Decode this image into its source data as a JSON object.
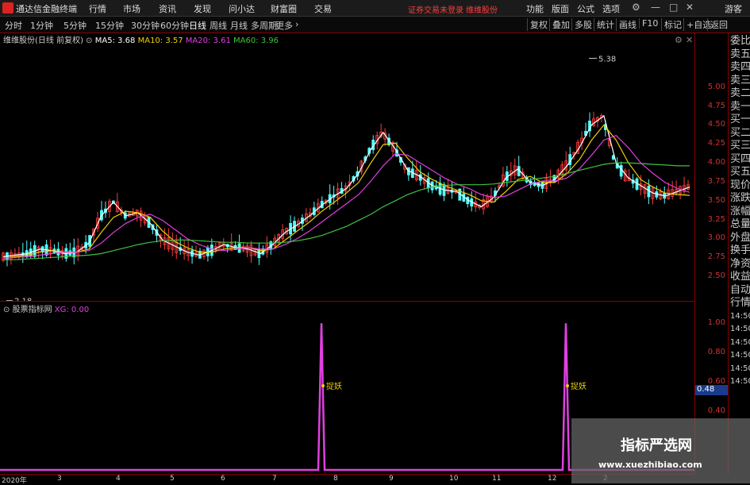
{
  "menubar": {
    "app_title": "通达信金融终端",
    "items": [
      "行情",
      "市场",
      "资讯",
      "发现",
      "问小达",
      "财富圈",
      "交易"
    ],
    "warning": "证券交易未登录",
    "stock_link": "维维股份",
    "right_items": [
      "功能",
      "版面",
      "公式",
      "选项"
    ],
    "guest": "游客"
  },
  "toolbar": {
    "periods": [
      "分时",
      "1分钟",
      "5分钟",
      "15分钟",
      "30分钟",
      "60分钟",
      "日线",
      "周线",
      "月线",
      "多周期",
      "更多"
    ],
    "active": "日线",
    "right_buttons": [
      "复权",
      "叠加",
      "多股",
      "统计",
      "画线",
      "F10",
      "标记",
      "+自选",
      "返回"
    ]
  },
  "main_legend": {
    "title": "维维股份(日线 前复权)",
    "ma5": "MA5: 3.68",
    "ma10": "MA10: 3.57",
    "ma20": "MA20: 3.61",
    "ma60": "MA60: 3.96"
  },
  "sub_legend": {
    "title": "股票指标网",
    "xg": "XG: 0.00"
  },
  "chart_data": [
    {
      "type": "candlestick",
      "title": "维维股份(日线 前复权)",
      "ylim": [
        2.25,
        5.5
      ],
      "yticks": [
        "5.00",
        "4.75",
        "4.50",
        "4.25",
        "4.00",
        "3.75",
        "3.50",
        "3.25",
        "3.00",
        "2.75",
        "2.50"
      ],
      "x_labels": [
        "2020年",
        "3",
        "4",
        "5",
        "6",
        "7",
        "8",
        "9",
        "10",
        "11",
        "12",
        "2"
      ],
      "annotations": {
        "max": "5.38",
        "min": "2.18"
      },
      "series": [
        {
          "name": "MA5",
          "color": "#ffffff",
          "values": [
            2.76,
            2.78,
            2.8,
            2.86,
            2.84,
            2.8,
            2.82,
            2.94,
            3.3,
            3.48,
            3.3,
            3.34,
            3.2,
            2.98,
            2.9,
            2.82,
            2.78,
            2.84,
            2.92,
            2.88,
            2.86,
            2.8,
            2.92,
            3.08,
            3.18,
            3.3,
            3.44,
            3.56,
            3.66,
            3.86,
            4.18,
            4.4,
            4.18,
            3.9,
            3.82,
            3.7,
            3.64,
            3.62,
            3.5,
            3.42,
            3.54,
            3.8,
            3.92,
            3.74,
            3.7,
            3.78,
            3.96,
            4.2,
            4.5,
            4.62,
            4.0,
            3.8,
            3.7,
            3.6,
            3.56,
            3.62,
            3.68
          ]
        },
        {
          "name": "MA10",
          "color": "#f0d000",
          "values": [
            2.74,
            2.76,
            2.78,
            2.82,
            2.84,
            2.82,
            2.82,
            2.86,
            3.08,
            3.28,
            3.36,
            3.34,
            3.28,
            3.1,
            2.96,
            2.88,
            2.82,
            2.82,
            2.86,
            2.88,
            2.88,
            2.84,
            2.86,
            2.98,
            3.1,
            3.22,
            3.36,
            3.48,
            3.6,
            3.74,
            4.0,
            4.24,
            4.26,
            4.06,
            3.88,
            3.78,
            3.7,
            3.64,
            3.58,
            3.5,
            3.48,
            3.62,
            3.78,
            3.82,
            3.74,
            3.74,
            3.86,
            4.04,
            4.3,
            4.5,
            4.3,
            4.0,
            3.78,
            3.68,
            3.6,
            3.58,
            3.57
          ]
        },
        {
          "name": "MA20",
          "color": "#e040e0",
          "values": [
            2.74,
            2.75,
            2.76,
            2.78,
            2.8,
            2.82,
            2.82,
            2.84,
            2.94,
            3.08,
            3.2,
            3.28,
            3.32,
            3.24,
            3.12,
            3.0,
            2.92,
            2.86,
            2.84,
            2.86,
            2.88,
            2.86,
            2.86,
            2.92,
            3.0,
            3.1,
            3.22,
            3.34,
            3.46,
            3.58,
            3.76,
            3.96,
            4.12,
            4.1,
            4.0,
            3.9,
            3.8,
            3.72,
            3.66,
            3.58,
            3.54,
            3.56,
            3.64,
            3.72,
            3.76,
            3.76,
            3.8,
            3.92,
            4.1,
            4.3,
            4.36,
            4.2,
            4.0,
            3.86,
            3.74,
            3.66,
            3.61
          ]
        },
        {
          "name": "MA60",
          "color": "#40c040",
          "values": [
            2.72,
            2.72,
            2.73,
            2.74,
            2.75,
            2.76,
            2.77,
            2.78,
            2.8,
            2.84,
            2.88,
            2.92,
            2.95,
            2.97,
            2.98,
            2.98,
            2.97,
            2.96,
            2.95,
            2.95,
            2.94,
            2.94,
            2.94,
            2.95,
            2.97,
            3.0,
            3.04,
            3.1,
            3.16,
            3.24,
            3.32,
            3.42,
            3.5,
            3.58,
            3.64,
            3.68,
            3.7,
            3.71,
            3.71,
            3.71,
            3.72,
            3.74,
            3.76,
            3.78,
            3.8,
            3.82,
            3.86,
            3.9,
            3.94,
            3.98,
            4.0,
            4.0,
            3.99,
            3.98,
            3.97,
            3.96,
            3.96
          ]
        }
      ]
    },
    {
      "type": "line",
      "title": "股票指标网",
      "series": [
        {
          "name": "XG",
          "color": "#e040e0",
          "spikes": [
            {
              "label": "捉妖",
              "value": 1.0,
              "x_label": "8"
            },
            {
              "label": "捉妖",
              "value": 1.0,
              "x_label": "12"
            }
          ]
        }
      ],
      "ylim": [
        0,
        1.05
      ],
      "yticks": [
        "1.00",
        "0.80",
        "0.60",
        "0.48",
        "0.40"
      ]
    }
  ],
  "right_panel": {
    "items": [
      "委比",
      "卖五",
      "卖四",
      "卖三",
      "卖二",
      "卖一",
      "买一",
      "买二",
      "买三",
      "买四",
      "买五",
      "现价",
      "涨跌",
      "涨幅",
      "总量",
      "外盘",
      "换手",
      "净资",
      "收益",
      "自动",
      "行情",
      "14:50",
      "14:50",
      "14:50",
      "14:50",
      "14:50",
      "14:50"
    ]
  },
  "cursor_value": "0.48",
  "watermark": {
    "title": "指标严选网",
    "url": "www.xuezhibiao.com"
  }
}
